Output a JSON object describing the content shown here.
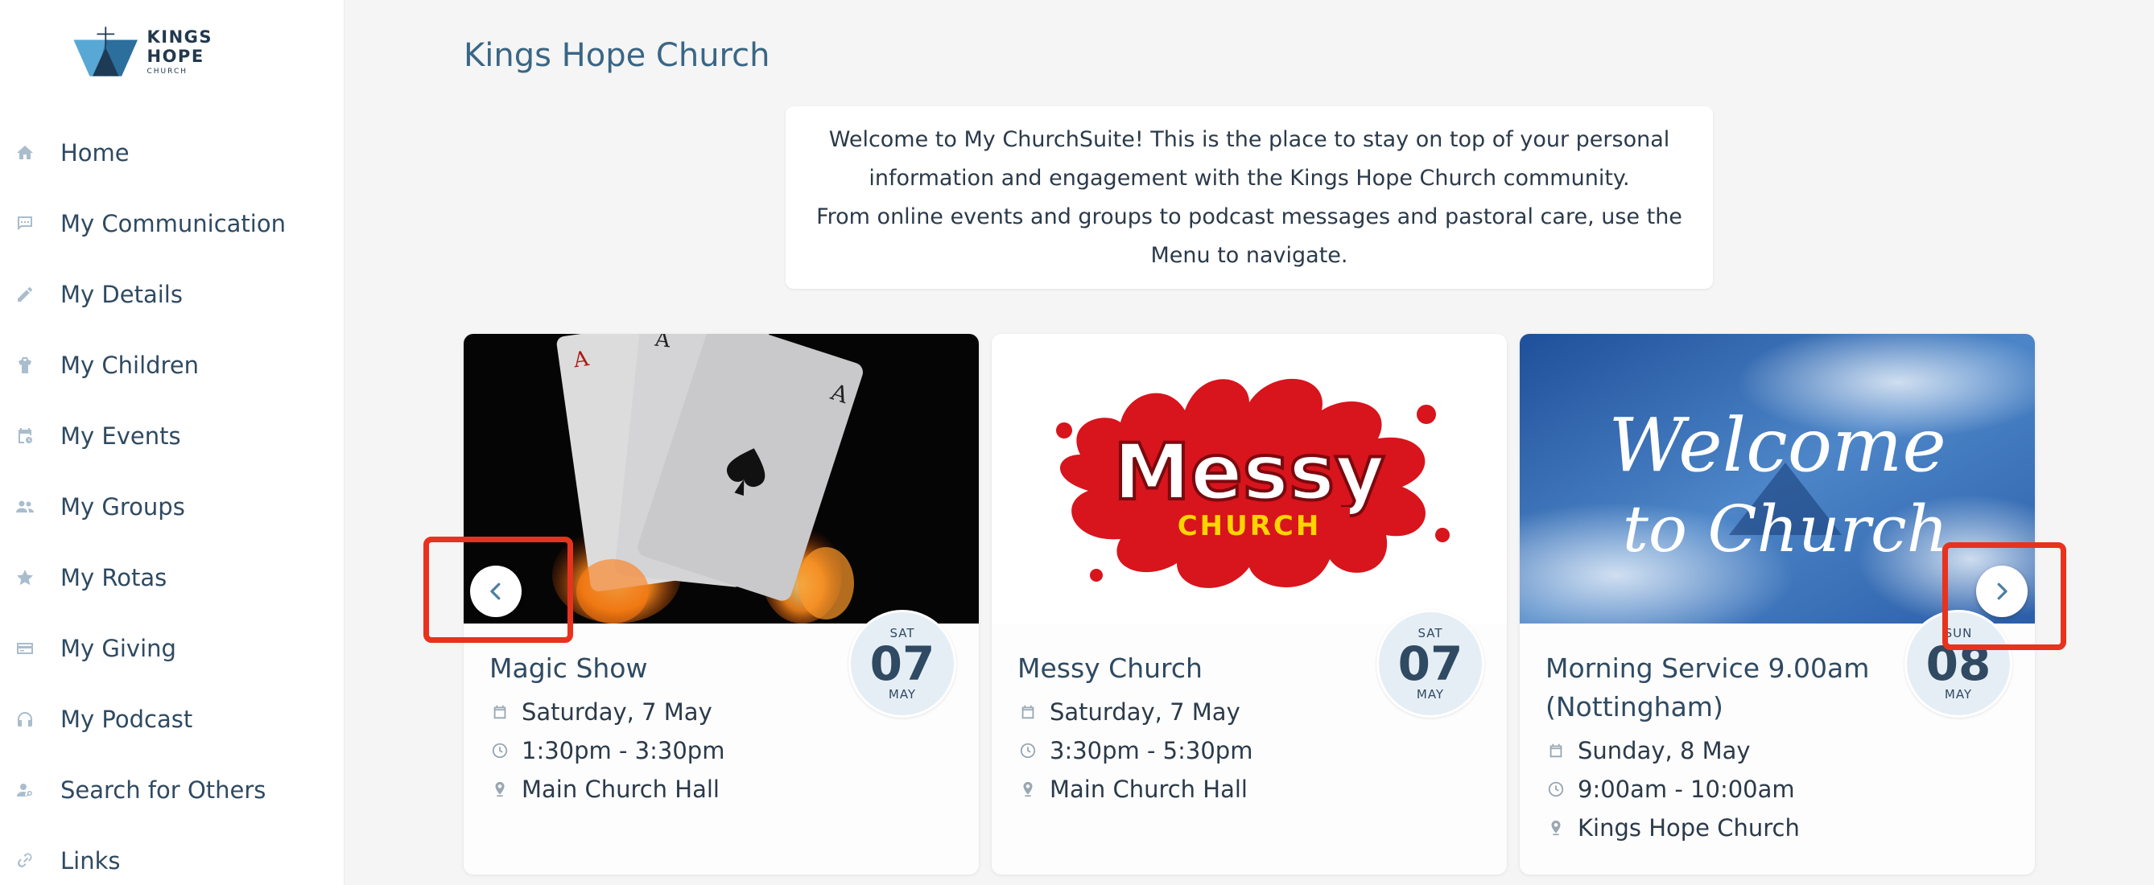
{
  "brand": {
    "name": "KINGS HOPE",
    "sub": "CHURCH"
  },
  "sidebar": {
    "items": [
      {
        "label": "Home",
        "icon": "home-icon"
      },
      {
        "label": "My Communication",
        "icon": "chat-icon"
      },
      {
        "label": "My Details",
        "icon": "pencil-icon"
      },
      {
        "label": "My Children",
        "icon": "child-icon"
      },
      {
        "label": "My Events",
        "icon": "calendar-clock-icon"
      },
      {
        "label": "My Groups",
        "icon": "group-icon"
      },
      {
        "label": "My Rotas",
        "icon": "star-icon"
      },
      {
        "label": "My Giving",
        "icon": "card-icon"
      },
      {
        "label": "My Podcast",
        "icon": "headphones-icon"
      },
      {
        "label": "Search for Others",
        "icon": "person-search-icon"
      },
      {
        "label": "Links",
        "icon": "link-icon"
      }
    ]
  },
  "main": {
    "title": "Kings Hope Church",
    "welcome": {
      "line1": "Welcome to My ChurchSuite! This is the place to stay on top of your personal information and engagement with the Kings Hope Church community.",
      "line2": "From online events and groups to podcast messages and pastoral care, use the Menu to navigate."
    },
    "events": [
      {
        "title": "Magic Show",
        "date": "Saturday, 7 May",
        "time": "1:30pm - 3:30pm",
        "location": "Main Church Hall",
        "badge": {
          "weekday": "SAT",
          "day": "07",
          "month": "MAY"
        }
      },
      {
        "title": "Messy Church",
        "date": "Saturday, 7 May",
        "time": "3:30pm - 5:30pm",
        "location": "Main Church Hall",
        "badge": {
          "weekday": "SAT",
          "day": "07",
          "month": "MAY"
        },
        "image_text": {
          "top": "Messy",
          "bottom": "CHURCH"
        }
      },
      {
        "title": "Morning Service 9.00am (Nottingham)",
        "date": "Sunday, 8 May",
        "time": "9:00am - 10:00am",
        "location": "Kings Hope Church",
        "badge": {
          "weekday": "SUN",
          "day": "08",
          "month": "MAY"
        },
        "image_text": {
          "line1": "Welcome",
          "line2": "to Church"
        }
      }
    ]
  },
  "colors": {
    "accent": "#3a6686",
    "nav_icon": "#a9bdcd",
    "highlight": "#e8321e",
    "badge_bg": "#e6eef5"
  }
}
